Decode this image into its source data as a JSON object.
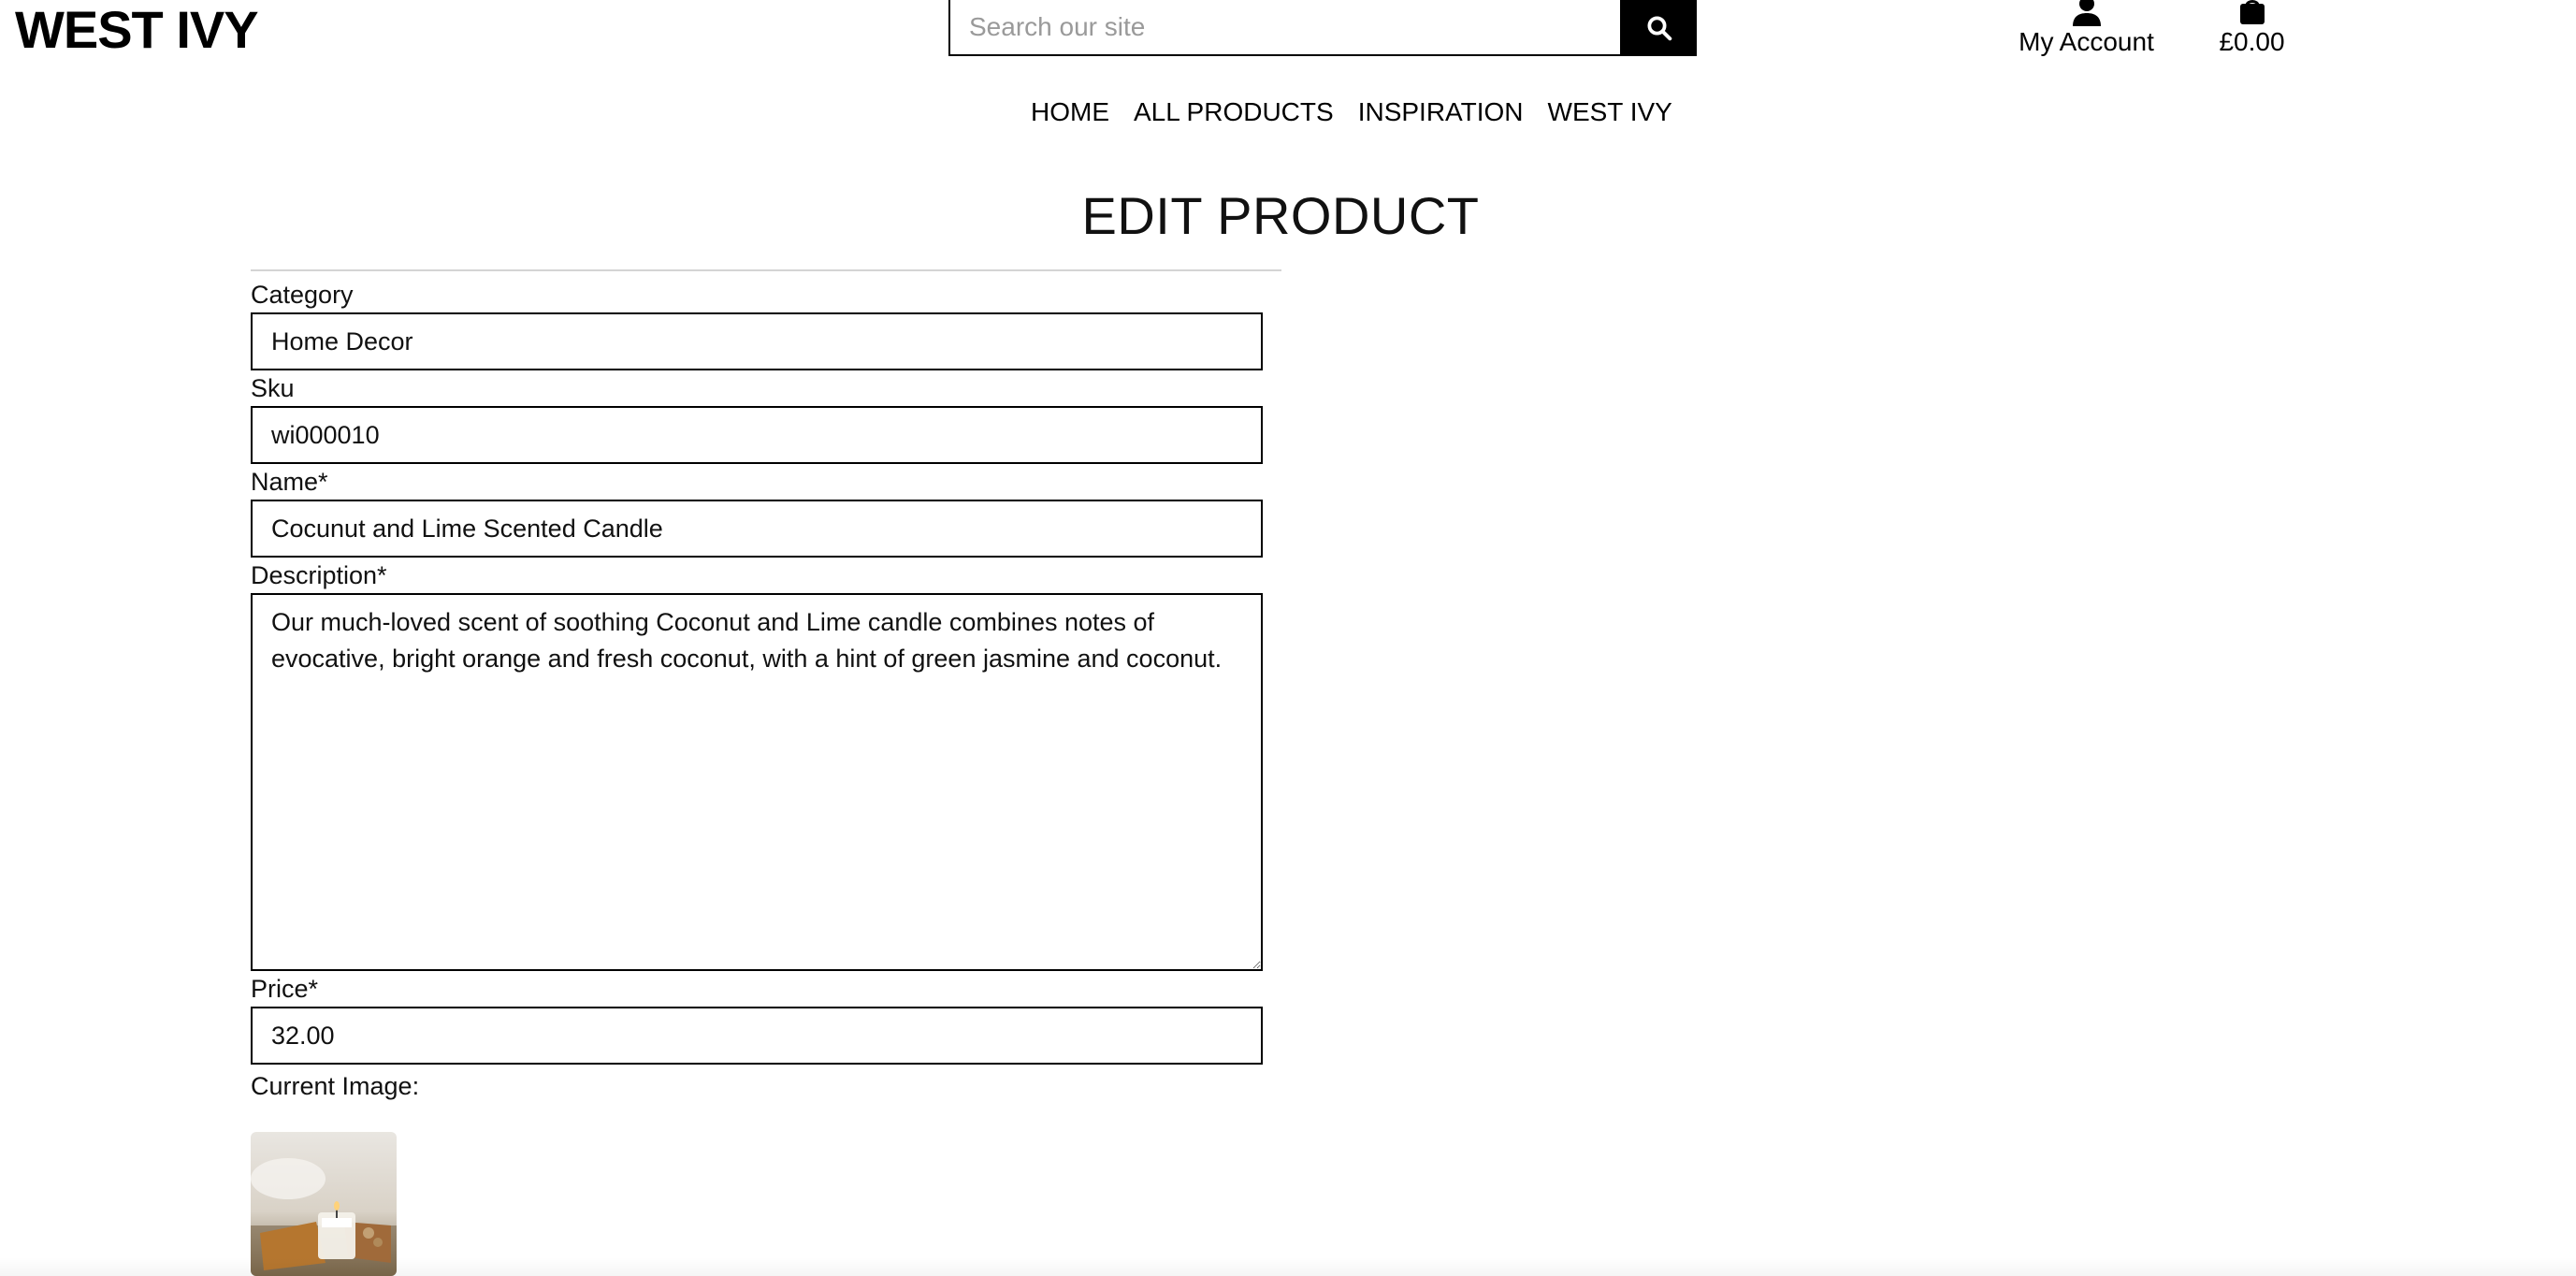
{
  "header": {
    "logo": "WEST IVY",
    "search_placeholder": "Search our site",
    "account_label": "My Account",
    "bag_total": "£0.00",
    "icons": {
      "search": "search-icon",
      "account": "user-icon",
      "bag": "shopping-bag-icon"
    }
  },
  "nav": {
    "items": [
      {
        "label": "HOME"
      },
      {
        "label": "ALL PRODUCTS"
      },
      {
        "label": "INSPIRATION"
      },
      {
        "label": "WEST IVY"
      }
    ]
  },
  "page": {
    "title": "EDIT PRODUCT"
  },
  "form": {
    "category": {
      "label": "Category",
      "value": "Home Decor"
    },
    "sku": {
      "label": "Sku",
      "value": "wi000010"
    },
    "name": {
      "label": "Name*",
      "value": "Cocunut and Lime Scented Candle"
    },
    "description": {
      "label": "Description*",
      "value": "Our much-loved scent of soothing Coconut and Lime candle combines notes of evocative, bright orange and fresh coconut, with a hint of green jasmine and coconut."
    },
    "price": {
      "label": "Price*",
      "value": "32.00"
    },
    "current_image": {
      "label": "Current Image:"
    }
  }
}
